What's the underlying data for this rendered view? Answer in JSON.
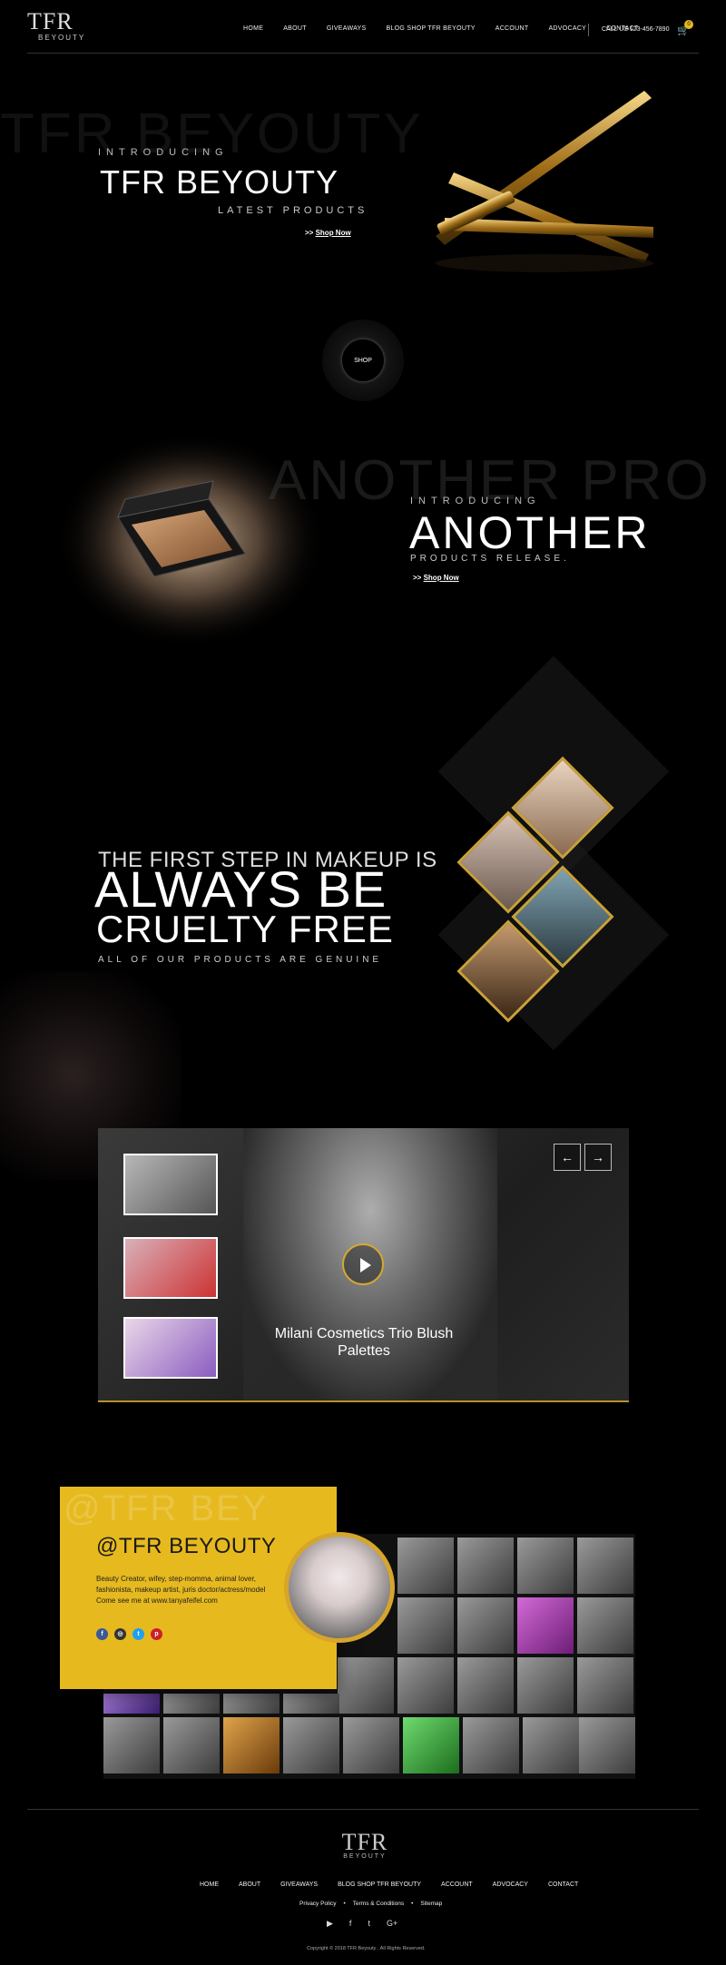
{
  "header": {
    "logo_big": "TFR",
    "logo_small": "BEYOUTY",
    "nav": [
      "HOME",
      "ABOUT",
      "GIVEAWAYS",
      "BLOG SHOP TFR BEYOUTY",
      "ACCOUNT",
      "ADVOCACY",
      "CONTACT"
    ],
    "call": "CALL US 123-456-7890",
    "cart_count": "0"
  },
  "hero1": {
    "ghost": "TFR BEYOUTY",
    "intro": "INTRODUCING",
    "title": "TFR BEYOUTY",
    "subtitle": "LATEST PRODUCTS",
    "cta_prefix": ">>",
    "cta": "Shop Now"
  },
  "shop_circle": {
    "label": "SHOP"
  },
  "hero2": {
    "ghost": "ANOTHER PRO",
    "intro": "INTRODUCING",
    "title": "ANOTHER",
    "subtitle": "PRODUCTS RELEASE.",
    "cta_prefix": ">>",
    "cta": "Shop Now"
  },
  "cruelty": {
    "line1": "THE FIRST STEP IN MAKEUP IS",
    "line2": "ALWAYS BE",
    "line3": "CRUELTY FREE",
    "line4": "ALL OF OUR PRODUCTS ARE GENUINE"
  },
  "video": {
    "caption": "Milani Cosmetics Trio Blush Palettes",
    "prev": "←",
    "next": "→"
  },
  "instagram": {
    "ghost": "@TFR BEY",
    "handle": "@TFR BEYOUTY",
    "bio": "Beauty Creator, wifey, step-momma, animal lover, fashionista, makeup artist, juris doctor/actress/model Come see me at www.tanyafeifel.com",
    "socials": [
      "f",
      "◎",
      "t",
      "p"
    ],
    "social_colors": [
      "#3b5998",
      "#333333",
      "#1da1f2",
      "#cb2027"
    ]
  },
  "footer": {
    "logo_big": "TFR",
    "logo_small": "BEYOUTY",
    "nav": [
      "HOME",
      "ABOUT",
      "GIVEAWAYS",
      "BLOG SHOP TFR BEYOUTY",
      "ACCOUNT",
      "ADVOCACY",
      "CONTACT"
    ],
    "links": [
      "Privacy Policy",
      "•",
      "Terms & Conditions",
      "•",
      "Sitemap"
    ],
    "socials": [
      "▶",
      "f",
      "t",
      "G+"
    ],
    "copyright": "Copyright © 2018 TFR Beyouty . All Rights Reserved."
  }
}
